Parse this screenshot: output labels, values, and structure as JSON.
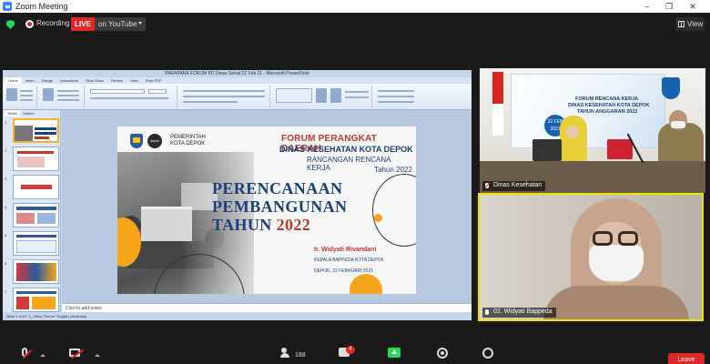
{
  "window": {
    "title": "Zoom Meeting"
  },
  "meeting_bar": {
    "recording_label": "Recording",
    "live_label": "LIVE",
    "stream_target": "on YouTube",
    "view_label": "View"
  },
  "powerpoint": {
    "window_title": "PARAPARA FORUM PD Dinas Sehat 22 Feb 21 - Microsoft PowerPoint",
    "tabs": [
      "Home",
      "Insert",
      "Design",
      "Animations",
      "Slide Show",
      "Review",
      "View",
      "Foxit PDF"
    ],
    "side_tabs": [
      "Slides",
      "Outline"
    ],
    "thumbnail_numbers": [
      "1",
      "2",
      "3",
      "4",
      "5",
      "6",
      "7"
    ],
    "notes_placeholder": "Click to add notes",
    "status_text": "Slide 1 of 61    \"1_Office Theme\"    English (Australia)"
  },
  "slide": {
    "gov_line1": "PEMERINTAH",
    "gov_line2": "KOTA DEPOK",
    "logo_text": "depok",
    "forum_title": "FORUM PERANGKAT DAERAH",
    "dinas": "DINAS KESEHATAN KOTA DEPOK",
    "rancangan": "RANCANGAN RENCANA KERJA",
    "tahun_small": "Tahun 2022",
    "title_line1": "PERENCANAAN",
    "title_line2": "PEMBANGUNAN",
    "title_line3_word": "TAHUN",
    "title_line3_year": "2022",
    "presenter": "Ir. Widyati Rivandani",
    "presenter_role": "KEPALA BAPPEDA KOTA DEPOK",
    "presenter_date": "DEPOK,  22  FEBRUARI 2021"
  },
  "tiles": [
    {
      "name": "Dinas Kesehatan",
      "banner_line1": "FORUM RENCANA KERJA",
      "banner_line2": "DINAS KESEHATAN KOTA DEPOK",
      "banner_line3": "TAHUN ANGGARAN 2022",
      "banner_date": "22 FEB 2021"
    },
    {
      "name": "02. Widyati Bappeda"
    }
  ],
  "toolbar": {
    "participants_count": "188",
    "chat_badge": "4",
    "leave_label": "Leave"
  },
  "colors": {
    "zoom_blue": "#2d8cff",
    "live_red": "#e02828",
    "share_green": "#23d959",
    "active_speaker": "#f0e300",
    "slide_navy": "#1b3f7a",
    "slide_red": "#c0392b",
    "slide_orange": "#f5a61b"
  }
}
